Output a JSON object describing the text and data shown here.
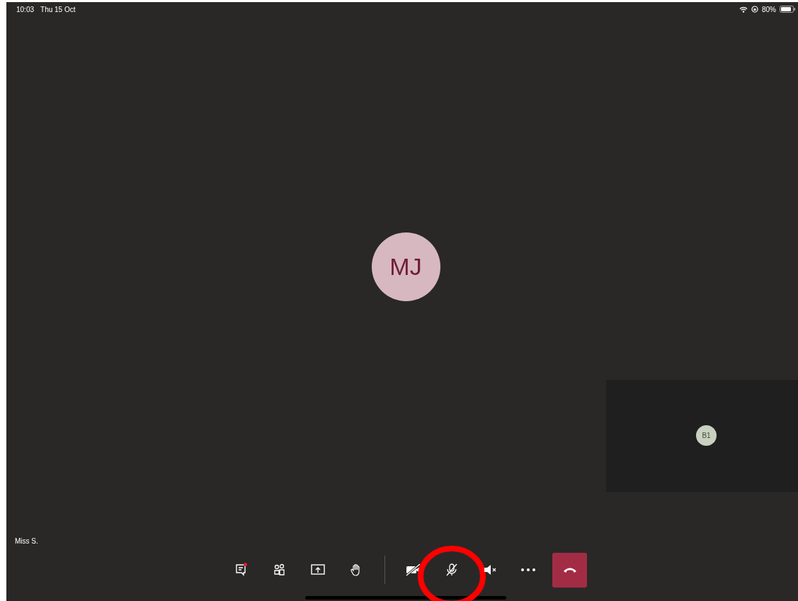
{
  "status_bar": {
    "time": "10:03",
    "date": "Thu 15 Oct",
    "battery": "80%"
  },
  "main_participant": {
    "initials": "MJ"
  },
  "self_view": {
    "initials": "B1"
  },
  "name_label": "Miss S.",
  "controls": [
    {
      "kind": "chat",
      "unread": true,
      "highlighted": false
    },
    {
      "kind": "people",
      "unread": false,
      "highlighted": false
    },
    {
      "kind": "share",
      "unread": false,
      "highlighted": false
    },
    {
      "kind": "hand",
      "unread": false,
      "highlighted": false
    },
    {
      "kind": "divider",
      "unread": false,
      "highlighted": false
    },
    {
      "kind": "video-off",
      "unread": false,
      "highlighted": false
    },
    {
      "kind": "mic-off",
      "unread": false,
      "highlighted": true
    },
    {
      "kind": "speaker-off",
      "unread": false,
      "highlighted": false
    },
    {
      "kind": "more",
      "unread": false,
      "highlighted": false
    },
    {
      "kind": "hangup",
      "unread": false,
      "highlighted": false
    }
  ]
}
